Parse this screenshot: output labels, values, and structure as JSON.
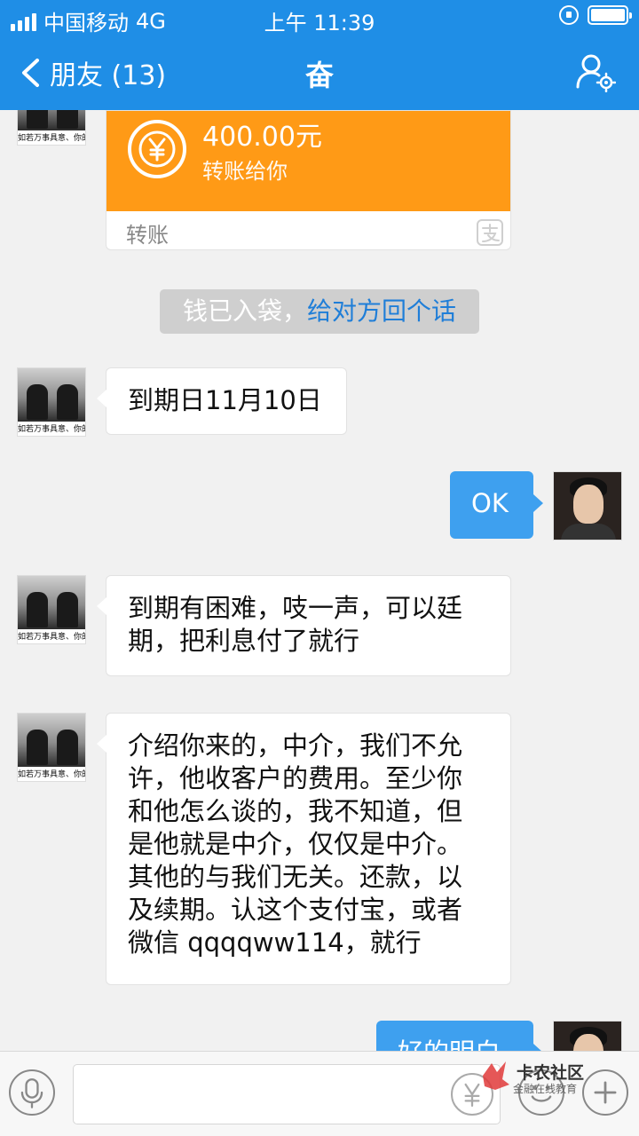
{
  "status_bar": {
    "carrier": "中国移动",
    "network": "4G",
    "time": "上午 11:39"
  },
  "nav": {
    "back_label": "朋友 (13)",
    "title": "奋"
  },
  "transfer": {
    "amount": "400.00元",
    "desc": "转账给你",
    "footer": "转账",
    "accent": "#ff9a16"
  },
  "notice": {
    "text": "钱已入袋，",
    "link": "给对方回个话"
  },
  "avatar_caption": "如若万事具意、你的价值",
  "messages": [
    {
      "side": "in",
      "text": "到期日11月10日"
    },
    {
      "side": "out",
      "text": "OK"
    },
    {
      "side": "in",
      "lines": [
        "到期有困难，吱一声，可以廷",
        "期，把利息付了就行"
      ]
    },
    {
      "side": "in",
      "lines": [
        "介绍你来的，中介，我们不允",
        "许，他收客户的费用。至少你",
        "和他怎么谈的，我不知道，但",
        "是他就是中介，仅仅是中介。",
        "其他的与我们无关。还款，以",
        "及续期。认这个支付宝，或者",
        "微信 qqqqww114，就行"
      ]
    },
    {
      "side": "out",
      "text": "好的明白"
    }
  ],
  "watermark": {
    "main": "卡农社区",
    "sub": "金融在线教育"
  },
  "colors": {
    "bar_blue": "#1f8ee6",
    "out_bubble": "#3ea0ef"
  }
}
